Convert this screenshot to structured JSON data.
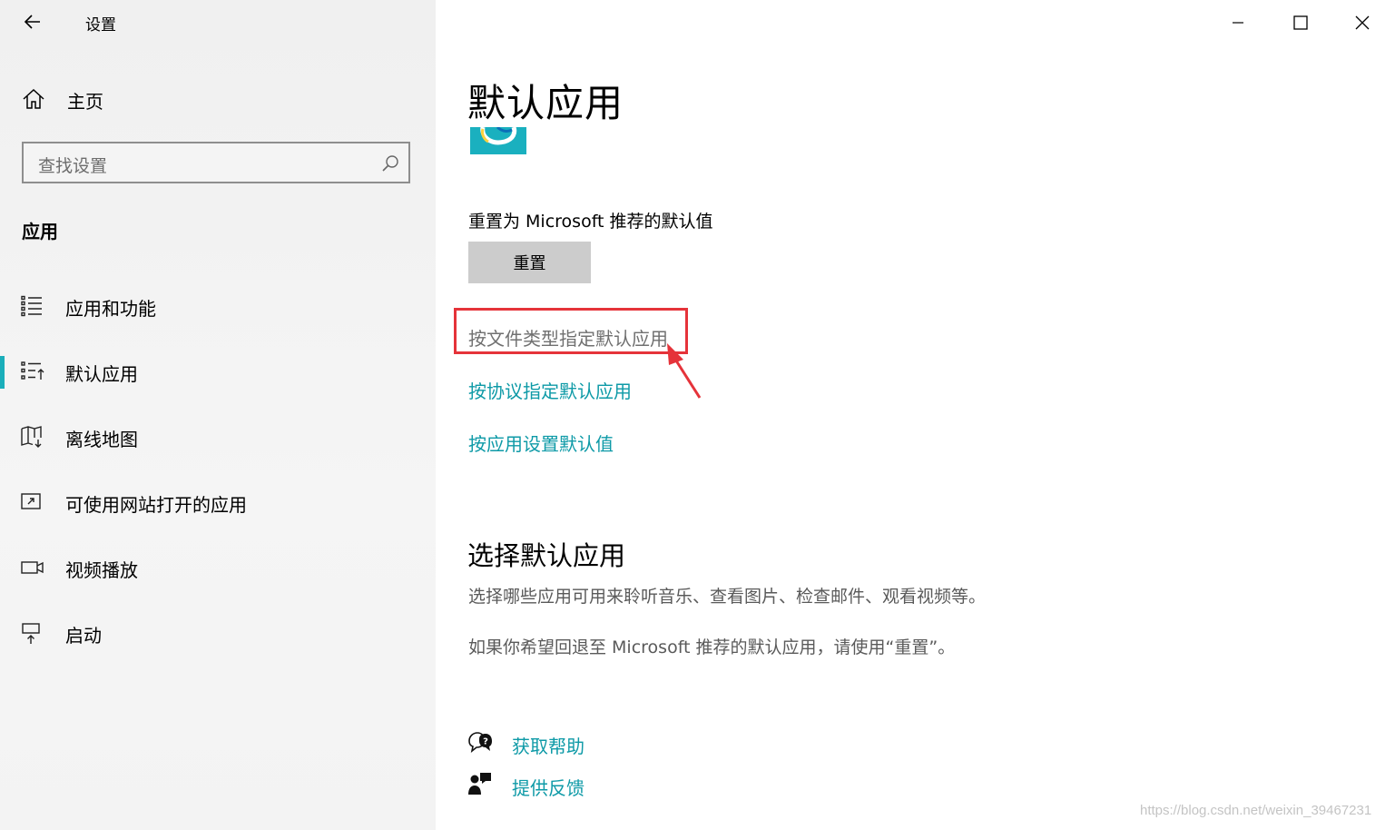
{
  "window": {
    "title": "设置",
    "controls": {
      "minimize": "minimize",
      "maximize": "maximize",
      "close": "close"
    }
  },
  "sidebar": {
    "home_label": "主页",
    "search_placeholder": "查找设置",
    "section_heading": "应用",
    "items": [
      {
        "label": "应用和功能",
        "icon": "apps-features-icon",
        "selected": false
      },
      {
        "label": "默认应用",
        "icon": "default-apps-icon",
        "selected": true
      },
      {
        "label": "离线地图",
        "icon": "offline-maps-icon",
        "selected": false
      },
      {
        "label": "可使用网站打开的应用",
        "icon": "apps-for-websites-icon",
        "selected": false
      },
      {
        "label": "视频播放",
        "icon": "video-playback-icon",
        "selected": false
      },
      {
        "label": "启动",
        "icon": "startup-icon",
        "selected": false
      }
    ]
  },
  "main": {
    "title": "默认应用",
    "reset_label": "重置为 Microsoft 推荐的默认值",
    "reset_button": "重置",
    "links": {
      "by_file_type": "按文件类型指定默认应用",
      "by_protocol": "按协议指定默认应用",
      "by_app": "按应用设置默认值"
    },
    "section2_title": "选择默认应用",
    "desc1": "选择哪些应用可用来聆听音乐、查看图片、检查邮件、观看视频等。",
    "desc2": "如果你希望回退至 Microsoft 推荐的默认应用，请使用“重置”。",
    "help_label": "获取帮助",
    "feedback_label": "提供反馈"
  },
  "colors": {
    "accent": "#1aaeba",
    "link": "#0e9aa7",
    "annotation": "#e5333a"
  },
  "watermark": "https://blog.csdn.net/weixin_39467231"
}
